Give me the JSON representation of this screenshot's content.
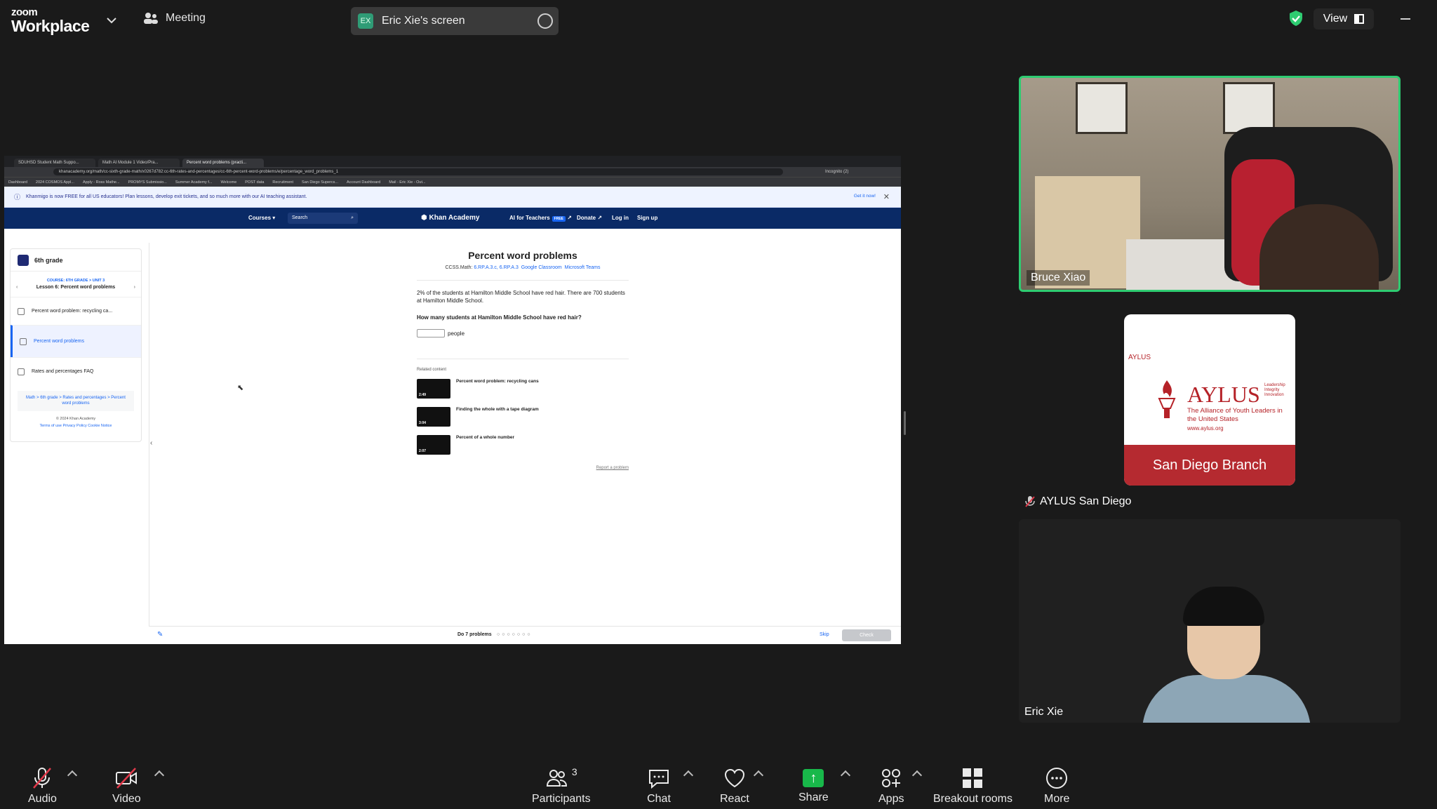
{
  "topbar": {
    "brand_line1": "zoom",
    "brand_line2": "Workplace",
    "meeting_label": "Meeting",
    "screen_badge": "EX",
    "screen_name": "Eric Xie's screen",
    "view_label": "View"
  },
  "browser": {
    "tabs": [
      "SDUHSD Student Math Suppo...",
      "Math AI Module 1 Video/Pra...",
      "Percent word problems (practi..."
    ],
    "url": "khanacademy.org/math/cc-sixth-grade-math/x0267d782:cc-6th-rates-and-percentages/cc-6th-percent-word-problems/e/percentage_word_problems_1",
    "incognito": "Incognito (2)",
    "bookmarks": [
      "Dashboard",
      "2024 COSMOS Appl...",
      "Apply - Ross Mathe...",
      "PROMYS Submissio...",
      "Summer Academy f...",
      "Welcome",
      "POST data",
      "Recruitment",
      "San Diego Supercs...",
      "Account Dashboard",
      "Mail - Eric Xie - Out..."
    ]
  },
  "ka": {
    "banner": "Khanmigo is now FREE for all US educators! Plan lessons, develop exit tickets, and so much more with our AI teaching assistant.",
    "banner_cta": "Get it now!",
    "nav_courses": "Courses",
    "nav_search": "Search",
    "logo": "Khan Academy",
    "nav_ai": "AI for Teachers",
    "nav_free": "FREE",
    "nav_donate": "Donate",
    "nav_login": "Log in",
    "nav_signup": "Sign up",
    "sidebar_title": "6th grade",
    "unit": "COURSE: 6TH GRADE > UNIT 3",
    "lesson": "Lesson 6: Percent word problems",
    "items": [
      "Percent word problem: recycling ca...",
      "Percent word problems",
      "Rates and percentages FAQ"
    ],
    "crumbs": "Math > 6th grade > Rates and percentages > Percent word problems",
    "copyright": "© 2024 Khan Academy",
    "legal": "Terms of use   Privacy Policy   Cookie Notice",
    "title": "Percent word problems",
    "standards_prefix": "CCSS.Math:",
    "standards": "6.RP.A.3.c, 6.RP.A.3",
    "classroom": "Google Classroom",
    "teams": "Microsoft Teams",
    "problem_text": "2% of the students at Hamilton Middle School have red hair. There are 700 students at Hamilton Middle School.",
    "question": "How many students at Hamilton Middle School have red hair?",
    "answer_unit": "people",
    "related_head": "Related content",
    "related": [
      {
        "title": "Percent word problem: recycling cans",
        "dur": "2:49"
      },
      {
        "title": "Finding the whole with a tape diagram",
        "dur": "3:04"
      },
      {
        "title": "Percent of a whole number",
        "dur": "2:07"
      }
    ],
    "report": "Report a problem",
    "do_problems": "Do 7 problems",
    "skip": "Skip",
    "check": "Check"
  },
  "participants": {
    "p1": "Bruce Xiao",
    "p2": "AYLUS San Diego",
    "p3": "Eric Xie"
  },
  "aylus_card": {
    "small": "AYLUS",
    "big": "AYLUS",
    "tag": "Leadership\nIntegrity\nInnovation",
    "sub": "The Alliance of Youth Leaders in the United States",
    "web": "www.aylus.org",
    "band": "San Diego Branch"
  },
  "toolbar": {
    "audio": "Audio",
    "video": "Video",
    "participants_count": "3",
    "participants": "Participants",
    "chat": "Chat",
    "react": "React",
    "share": "Share",
    "apps": "Apps",
    "breakout": "Breakout rooms",
    "more": "More"
  },
  "colors": {
    "active_speaker": "#2ecc71",
    "share_green": "#18b84a",
    "ka_navy": "#0a2a66",
    "aylus_red": "#b52a30"
  }
}
